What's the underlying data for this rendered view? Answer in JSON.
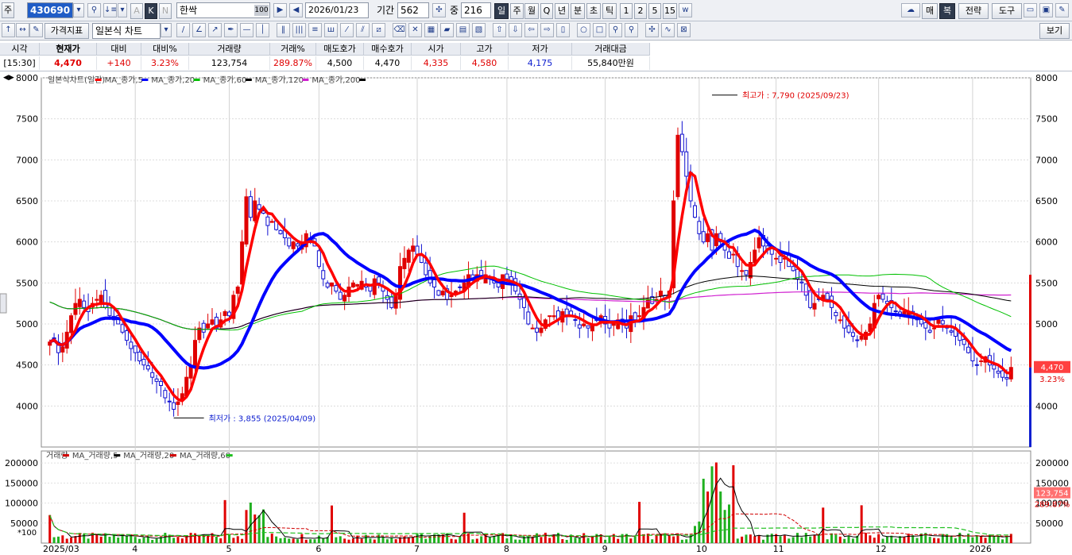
{
  "toolbar1": {
    "type_label": "주",
    "code": "430690",
    "name": "한싹",
    "zoom": "100",
    "date": "2026/01/23",
    "period_label": "기간",
    "period_value": "562",
    "overlap_label": "중",
    "overlap_value": "216",
    "periods": [
      "일",
      "주",
      "월",
      "Q",
      "년",
      "분",
      "초",
      "틱",
      "1",
      "2",
      "5",
      "15"
    ],
    "btn_buy": "매",
    "btn_copy": "복",
    "btn_strategy": "전략",
    "btn_tools": "도구",
    "k_label": "K",
    "a_label": "A",
    "n_label": "N"
  },
  "toolbar2": {
    "price_indicator": "가격지표",
    "chart_type": "일본식 차트",
    "view_btn": "보기"
  },
  "quote": {
    "headers": [
      "시각",
      "현재가",
      "대비",
      "대비%",
      "거래량",
      "거래%",
      "매도호가",
      "매수호가",
      "시가",
      "고가",
      "저가",
      "거래대금"
    ],
    "values": [
      "[15:30]",
      "4,470",
      "+140",
      "3.23%",
      "123,754",
      "289.87%",
      "4,500",
      "4,470",
      "4,335",
      "4,580",
      "4,175",
      "55,840만원"
    ]
  },
  "chart_data": {
    "type": "candlestick",
    "price_legend": [
      "일본식차트(일간)",
      "MA_종가,5",
      "MA_종가,20",
      "MA_종가,60",
      "MA_종가,120",
      "MA_종가,200"
    ],
    "volume_legend": [
      "거래량",
      "MA_거래량,5",
      "MA_거래량,20",
      "MA_거래량,60"
    ],
    "price_ylim": [
      3500,
      8000
    ],
    "price_ticks": [
      4000,
      4500,
      5000,
      5500,
      6000,
      6500,
      7000,
      7500,
      8000
    ],
    "volume_ylim": [
      0,
      230000
    ],
    "volume_ticks": [
      50000,
      100000,
      150000,
      200000
    ],
    "volume_unit": "*100",
    "x_labels": [
      "2025/03",
      "4",
      "5",
      "6",
      "7",
      "8",
      "9",
      "10",
      "11",
      "12",
      "2026"
    ],
    "high_annotation": "최고가 : 7,790 (2025/09/23)",
    "low_annotation": "최저가 : 3,855 (2025/04/09)",
    "current_price": "4,470",
    "current_change": "3.23%",
    "current_volume": "123,754",
    "current_volume_pct": "289.87%",
    "colors": {
      "up": "#e00000",
      "down": "#1010d0",
      "ma5": "#ff0000",
      "ma20": "#0000ff",
      "ma60": "#00c000",
      "ma120": "#000000",
      "ma200": "#d020d0"
    },
    "closes": [
      4780,
      4830,
      4650,
      4720,
      4900,
      5100,
      5250,
      5300,
      5200,
      5150,
      5250,
      5300,
      5350,
      5200,
      5100,
      5050,
      5000,
      4900,
      4800,
      4700,
      4650,
      4550,
      4500,
      4450,
      4350,
      4300,
      4250,
      4100,
      4050,
      3960,
      4050,
      4150,
      4350,
      4500,
      4800,
      4950,
      4900,
      5000,
      5050,
      4950,
      5050,
      5150,
      5100,
      5350,
      5450,
      6000,
      6550,
      6300,
      6500,
      6400,
      6350,
      6200,
      6250,
      6150,
      6100,
      6050,
      5950,
      6000,
      5950,
      5980,
      6100,
      6000,
      5950,
      5700,
      5550,
      5450,
      5500,
      5400,
      5300,
      5350,
      5450,
      5500,
      5480,
      5520,
      5450,
      5400,
      5550,
      5500,
      5400,
      5300,
      5200,
      5350,
      5700,
      5800,
      5900,
      5950,
      5850,
      5750,
      5600,
      5500,
      5450,
      5350,
      5400,
      5300,
      5350,
      5400,
      5450,
      5500,
      5600,
      5550,
      5600,
      5550,
      5600,
      5550,
      5500,
      5450,
      5600,
      5550,
      5500,
      5400,
      5300,
      5200,
      5000,
      4950,
      4900,
      4950,
      5050,
      5100,
      5100,
      5050,
      5150,
      5100,
      5100,
      5050,
      4950,
      5000,
      4950,
      5000,
      5050,
      5100,
      5000,
      4950,
      5000,
      5050,
      5000,
      4950,
      5100,
      5050,
      5100,
      5200,
      5300,
      5250,
      5300,
      5400,
      5300,
      5400,
      6500,
      7300,
      7100,
      6800,
      6500,
      6300,
      6100,
      6000,
      6100,
      5900,
      6100,
      6000,
      5900,
      5800,
      5850,
      5700,
      5650,
      5600,
      5750,
      5900,
      6050,
      5950,
      5900,
      5850,
      5800,
      5750,
      5800,
      5700,
      5650,
      5550,
      5500,
      5350,
      5200,
      5250,
      5300,
      5350,
      5300,
      5200,
      5100,
      5050,
      4950,
      4900,
      4850,
      4800,
      4850,
      4900,
      5000,
      5250,
      5350,
      5300,
      5250,
      5200,
      5150,
      5100,
      5150,
      5150,
      5100,
      5050,
      5000,
      4950,
      4900,
      4950,
      5050,
      5000,
      4950,
      4900,
      4850,
      4800,
      4750,
      4650,
      4550,
      4500,
      4550,
      4600,
      4500,
      4450,
      4400,
      4350,
      4330,
      4470
    ],
    "high_idx": 155,
    "low_idx": 29
  }
}
